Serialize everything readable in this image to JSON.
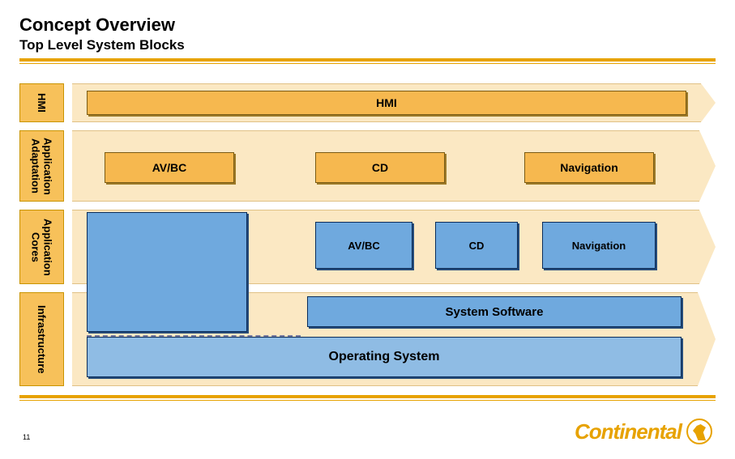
{
  "title": "Concept Overview",
  "subtitle": "Top Level System Blocks",
  "page_number": "11",
  "logo_text": "Continental",
  "side_labels": {
    "hmi": "HMI",
    "app_adapt": "Application\nAdaptation",
    "app_cores": "Application\nCores",
    "infra": "Infrastructure"
  },
  "row1": {
    "hmi": "HMI"
  },
  "row2": {
    "avbc": "AV/BC",
    "cd": "CD",
    "nav": "Navigation"
  },
  "row3": {
    "avbc": "AV/BC",
    "cd": "CD",
    "nav": "Navigation"
  },
  "row4": {
    "sys_sw": "System Software",
    "os": "Operating System"
  }
}
